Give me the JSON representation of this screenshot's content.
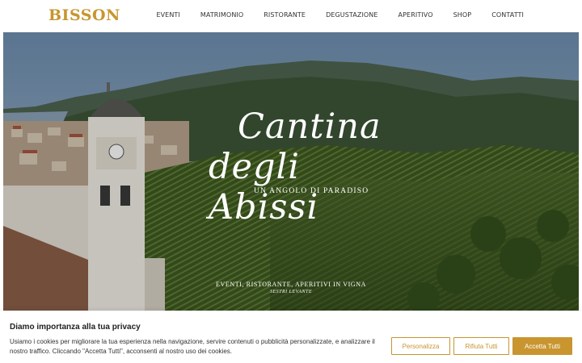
{
  "header": {
    "logo": "BISSON",
    "nav": [
      "EVENTI",
      "MATRIMONIO",
      "RISTORANTE",
      "DEGUSTAZIONE",
      "APERITIVO",
      "SHOP",
      "CONTATTI"
    ]
  },
  "hero": {
    "title_line1": "Cantina",
    "title_line2": "degli Abissi",
    "tagline": "UN ANGOLO DI PARADISO",
    "subtitle": "EVENTI, RISTORANTE, APERITIVI IN VIGNA",
    "location": "SESTRI LEVANTE"
  },
  "cookie": {
    "title": "Diamo importanza alla tua privacy",
    "text": "Usiamo i cookies per migliorare la tua esperienza nella navigazione, servire contenuti o pubblicità personalizzate, e analizzare il nostro traffico. Cliccando \"Accetta Tutti\", acconsenti al nostro uso dei cookies.",
    "customize": "Personalizza",
    "reject": "Rifiuta Tutti",
    "accept": "Accetta Tutti"
  },
  "colors": {
    "accent": "#c8952f"
  }
}
